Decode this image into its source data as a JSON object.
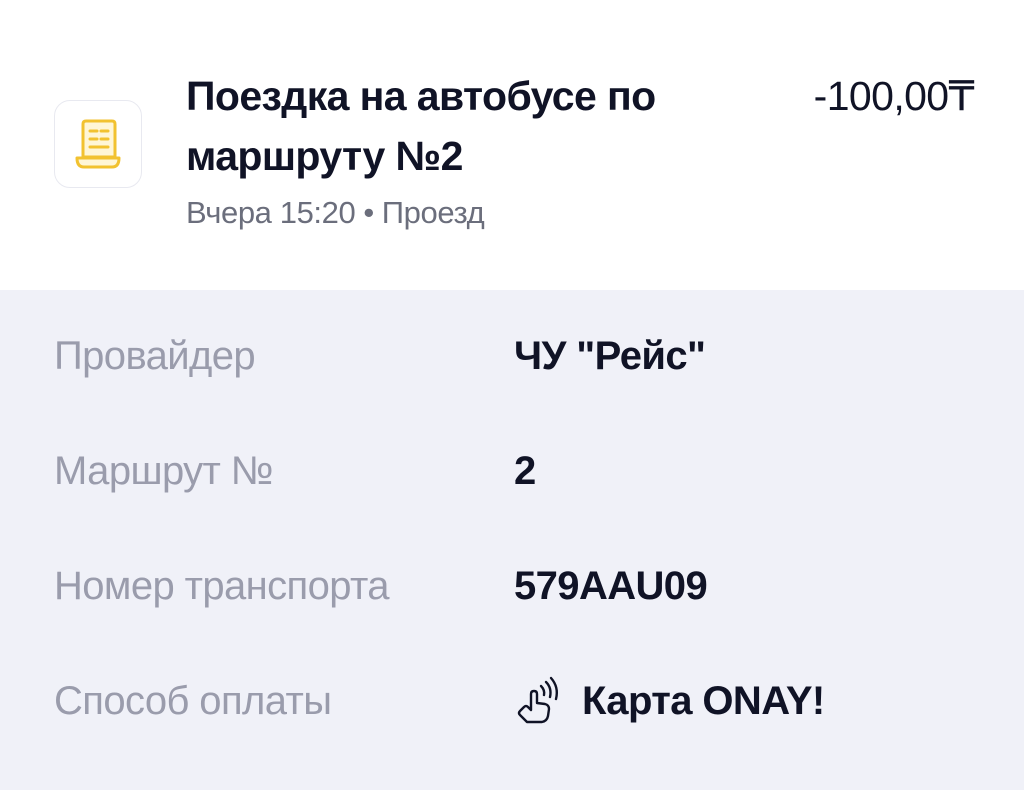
{
  "transaction": {
    "icon": "receipt-icon",
    "title": "Поездка на автобусе по маршруту №2",
    "amount": "-100,00₸",
    "date_time": "Вчера 15:20",
    "separator": "•",
    "category": "Проезд"
  },
  "details": {
    "rows": [
      {
        "label": "Провайдер",
        "value": "ЧУ \"Рейс\""
      },
      {
        "label": "Маршрут №",
        "value": "2"
      },
      {
        "label": "Номер транспорта",
        "value": "579AAU09"
      },
      {
        "label": "Способ оплаты",
        "value": "Карта ONAY!",
        "icon": "contactless-tap-icon"
      }
    ]
  },
  "colors": {
    "title_text": "#101326",
    "muted_text": "#6b6e7c",
    "label_text": "#9a9cac",
    "details_background": "#f0f1f8",
    "receipt_icon": "#f2c230"
  }
}
